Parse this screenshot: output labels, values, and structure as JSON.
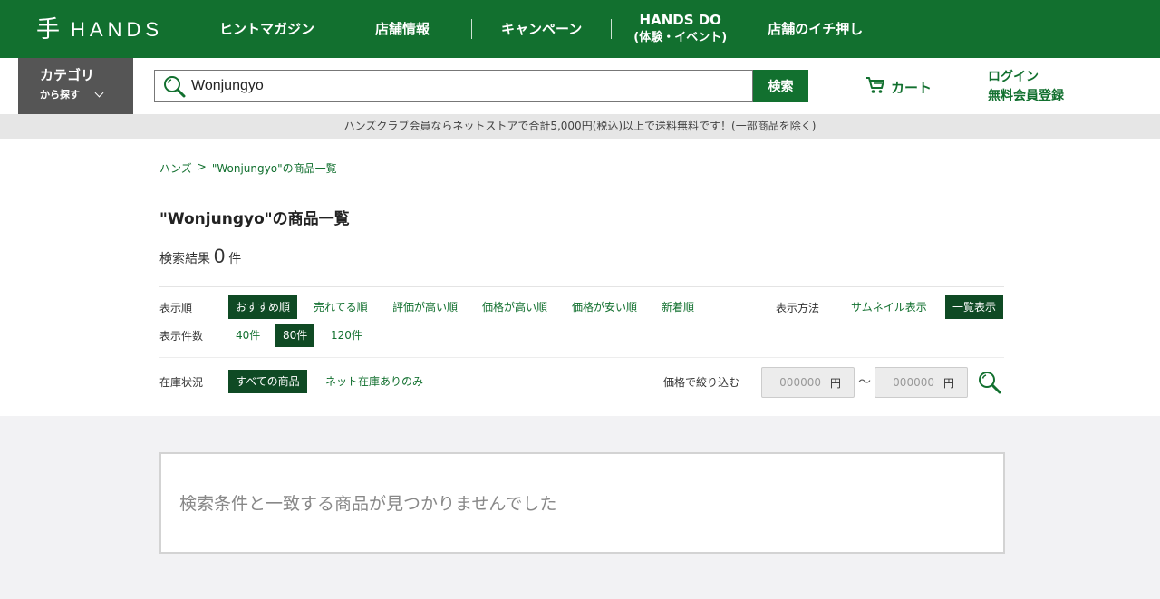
{
  "header": {
    "logo_mark": "手",
    "logo_text": "HANDS",
    "nav": [
      {
        "label": "ヒントマガジン"
      },
      {
        "label": "店舗情報"
      },
      {
        "label": "キャンペーン"
      },
      {
        "label": "HANDS DO",
        "sub": "(体験・イベント)"
      },
      {
        "label": "店舗のイチ押し"
      }
    ]
  },
  "category_button": {
    "line1": "カテゴリ",
    "line2": "から探す"
  },
  "search": {
    "value": "Wonjungyo",
    "button": "検索"
  },
  "cart_label": "カート",
  "account": {
    "login": "ログイン",
    "register": "無料会員登録"
  },
  "notice": "ハンズクラブ会員ならネットストアで合計5,000円(税込)以上で送料無料です！(一部商品を除く)",
  "breadcrumb": {
    "home": "ハンズ",
    "separator": ">",
    "current": "\"Wonjungyo\"の商品一覧"
  },
  "page_title": "\"Wonjungyo\"の商品一覧",
  "results": {
    "label": "検索結果",
    "count": "0",
    "unit": "件"
  },
  "sort": {
    "label": "表示順",
    "options": [
      "おすすめ順",
      "売れてる順",
      "評価が高い順",
      "価格が高い順",
      "価格が安い順",
      "新着順"
    ],
    "selected": "おすすめ順"
  },
  "display_mode": {
    "label": "表示方法",
    "options": [
      "サムネイル表示",
      "一覧表示"
    ],
    "selected": "一覧表示"
  },
  "per_page": {
    "label": "表示件数",
    "options": [
      "40件",
      "80件",
      "120件"
    ],
    "selected": "80件"
  },
  "stock": {
    "label": "在庫状況",
    "options": [
      "すべての商品",
      "ネット在庫ありのみ"
    ],
    "selected": "すべての商品"
  },
  "price_filter": {
    "label": "価格で絞り込む",
    "min_placeholder": "000000",
    "max_placeholder": "000000",
    "unit": "円",
    "range_separator": "〜"
  },
  "empty_message": "検索条件と一致する商品が見つかりませんでした",
  "colors": {
    "brand_green": "#12702f",
    "active_dark": "#0f4a24",
    "category_gray": "#555555"
  }
}
